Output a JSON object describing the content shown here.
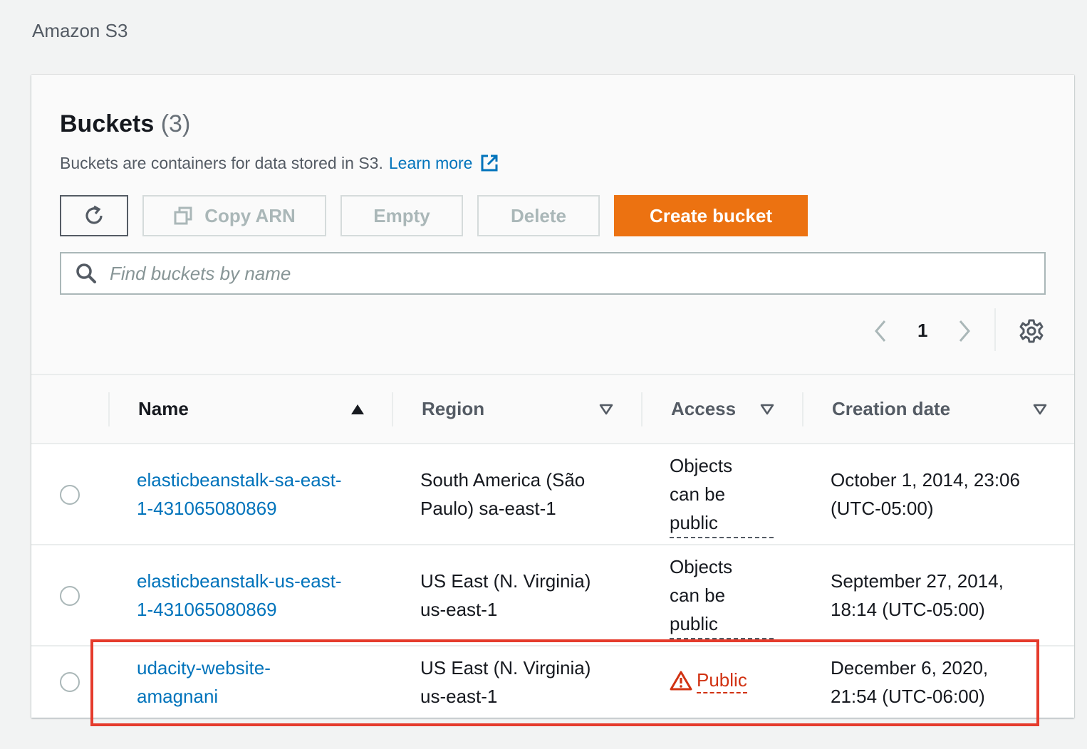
{
  "breadcrumb": "Amazon S3",
  "header": {
    "title": "Buckets",
    "count": "(3)",
    "description": "Buckets are containers for data stored in S3.",
    "learn_more": "Learn more"
  },
  "actions": {
    "copy_arn": "Copy ARN",
    "empty": "Empty",
    "delete": "Delete",
    "create_bucket": "Create bucket"
  },
  "search": {
    "placeholder": "Find buckets by name"
  },
  "pagination": {
    "page": "1"
  },
  "columns": {
    "name": "Name",
    "region": "Region",
    "access": "Access",
    "creation_date": "Creation date"
  },
  "rows": [
    {
      "name_line1": "elasticbeanstalk-sa-east-",
      "name_line2": "1-431065080869",
      "region_line1": "South America (São",
      "region_line2": "Paulo) sa-east-1",
      "access_line1": "Objects",
      "access_line2": "can be",
      "access_line3": "public",
      "date_line1": "October 1, 2014, 23:06",
      "date_line2": "(UTC-05:00)"
    },
    {
      "name_line1": "elasticbeanstalk-us-east-",
      "name_line2": "1-431065080869",
      "region_line1": "US East (N. Virginia)",
      "region_line2": "us-east-1",
      "access_line1": "Objects",
      "access_line2": "can be",
      "access_line3": "public",
      "date_line1": "September 27, 2014,",
      "date_line2": "18:14 (UTC-05:00)"
    },
    {
      "name_line1": "udacity-website-",
      "name_line2": "amagnani",
      "region_line1": "US East (N. Virginia)",
      "region_line2": "us-east-1",
      "access": "Public",
      "date_line1": "December 6, 2020,",
      "date_line2": "21:54 (UTC-06:00)"
    }
  ],
  "colors": {
    "primary_button": "#ec7211",
    "link": "#0073bb",
    "public_warning": "#d13212",
    "highlight_box": "#e53b2c"
  }
}
